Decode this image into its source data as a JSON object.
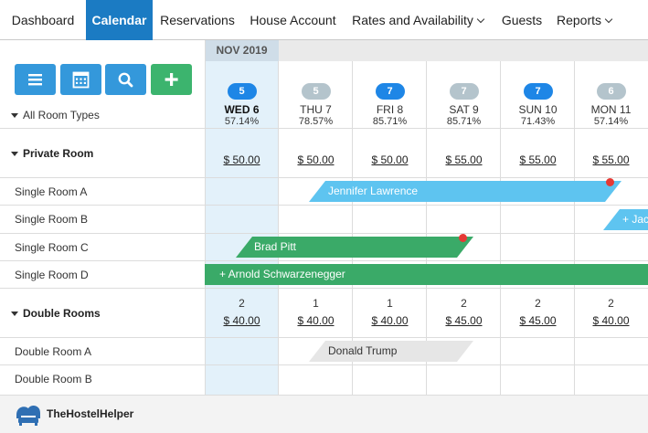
{
  "nav": {
    "items": [
      {
        "label": "Dashboard"
      },
      {
        "label": "Calendar"
      },
      {
        "label": "Reservations"
      },
      {
        "label": "House Account"
      },
      {
        "label": "Rates and Availability"
      },
      {
        "label": "Guests"
      },
      {
        "label": "Reports"
      }
    ],
    "active": "Calendar"
  },
  "calendar": {
    "month": "NOV 2019",
    "filter_label": "All Room Types",
    "days": [
      {
        "badge": "5",
        "badge_style": "blue",
        "name": "WED 6",
        "occupancy": "57.14%",
        "today": true
      },
      {
        "badge": "5",
        "badge_style": "gray",
        "name": "THU 7",
        "occupancy": "78.57%"
      },
      {
        "badge": "7",
        "badge_style": "blue",
        "name": "FRI 8",
        "occupancy": "85.71%"
      },
      {
        "badge": "7",
        "badge_style": "gray",
        "name": "SAT 9",
        "occupancy": "85.71%"
      },
      {
        "badge": "7",
        "badge_style": "blue",
        "name": "SUN 10",
        "occupancy": "71.43%"
      },
      {
        "badge": "6",
        "badge_style": "gray",
        "name": "MON 11",
        "occupancy": "57.14%"
      }
    ],
    "categories": [
      {
        "name": "Private Room",
        "availability": [
          "",
          "",
          "",
          "",
          "",
          ""
        ],
        "prices": [
          "$ 50.00",
          "$ 50.00",
          "$ 50.00",
          "$ 55.00",
          "$ 55.00",
          "$ 55.00"
        ],
        "rooms": [
          "Single Room A",
          "Single Room B",
          "Single Room C",
          "Single Room D"
        ]
      },
      {
        "name": "Double Rooms",
        "availability": [
          "2",
          "1",
          "1",
          "2",
          "2",
          "2"
        ],
        "prices": [
          "$ 40.00",
          "$ 40.00",
          "$ 40.00",
          "$ 45.00",
          "$ 45.00",
          "$ 40.00"
        ],
        "rooms": [
          "Double Room A",
          "Double Room B"
        ]
      }
    ],
    "bookings": [
      {
        "guest": "Jennifer Lawrence",
        "room": "Single Room A",
        "color": "#5ec4f0",
        "alert": true
      },
      {
        "guest": "+ Jac",
        "room": "Single Room B",
        "color": "#5ec4f0"
      },
      {
        "guest": "Brad Pitt",
        "room": "Single Room C",
        "color": "#3aaa68",
        "alert": true
      },
      {
        "guest": "+ Arnold Schwarzenegger",
        "room": "Single Room D",
        "color": "#3aaa68"
      },
      {
        "guest": "Donald Trump",
        "room": "Double Room A",
        "color": "#e6e6e6"
      }
    ]
  },
  "toolbar": {
    "buttons": [
      "list-icon",
      "calendar-icon",
      "search-icon",
      "plus-icon"
    ]
  },
  "footer": {
    "brand": "TheHostelHelper"
  }
}
